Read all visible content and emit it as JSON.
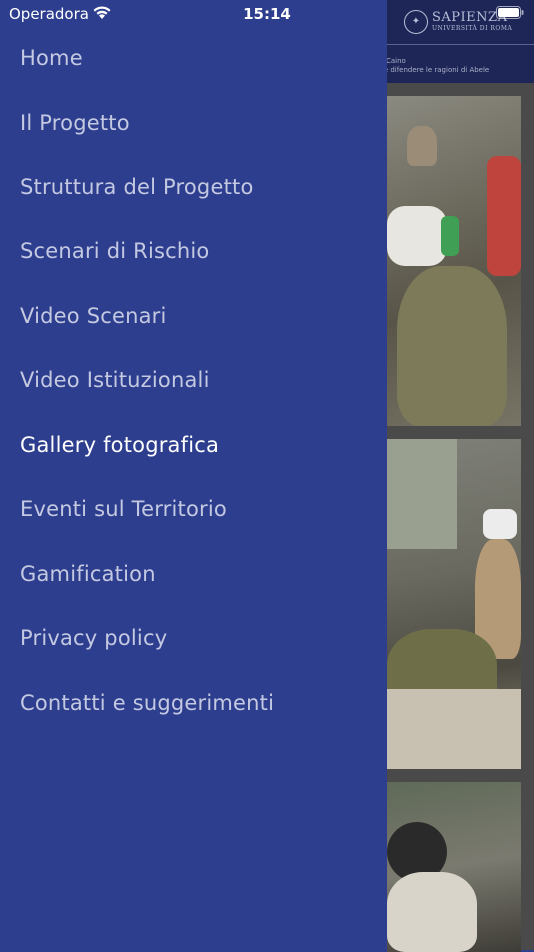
{
  "status_bar": {
    "carrier": "Operadora",
    "time": "15:14"
  },
  "header": {
    "logo_name": "SAPIENZA",
    "logo_sub": "UNIVERSITÀ DI ROMA",
    "tagline_line1": "anni di Caino",
    "tagline_line2": "capire e difendere le ragioni di Abele"
  },
  "menu": {
    "items": [
      {
        "label": "Home"
      },
      {
        "label": "Il Progetto"
      },
      {
        "label": "Struttura del Progetto"
      },
      {
        "label": "Scenari di Rischio"
      },
      {
        "label": "Video Scenari"
      },
      {
        "label": "Video Istituzionali"
      },
      {
        "label": "Gallery fotografica"
      },
      {
        "label": "Eventi sul Territorio"
      },
      {
        "label": "Gamification"
      },
      {
        "label": "Privacy policy"
      },
      {
        "label": "Contatti e suggerimenti"
      }
    ],
    "active_index": 6
  },
  "colors": {
    "drawer_bg": "#2e3e8e",
    "menu_text": "#c4c9e2",
    "menu_active_text": "#ffffff",
    "header_bg": "#1d2657"
  },
  "icons": [
    "wifi-icon",
    "battery-icon",
    "sapienza-seal-icon"
  ]
}
